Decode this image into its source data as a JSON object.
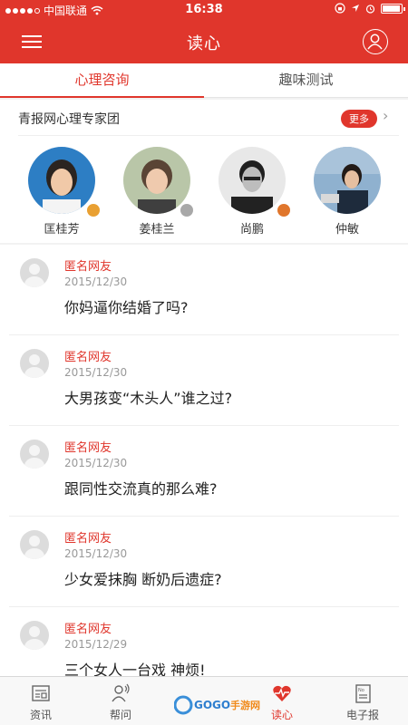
{
  "status_bar": {
    "carrier": "中国联通",
    "time": "16:38"
  },
  "header": {
    "title": "读心"
  },
  "tabs": [
    {
      "label": "心理咨询",
      "active": true
    },
    {
      "label": "趣味测试",
      "active": false
    }
  ],
  "experts": {
    "title": "青报网心理专家团",
    "more_label": "更多",
    "items": [
      {
        "name": "匡桂芳"
      },
      {
        "name": "姜桂兰"
      },
      {
        "name": "尚鹏"
      },
      {
        "name": "仲敏"
      }
    ]
  },
  "questions": [
    {
      "user": "匿名网友",
      "date": "2015/12/30",
      "question": "你妈逼你结婚了吗?"
    },
    {
      "user": "匿名网友",
      "date": "2015/12/30",
      "question": "大男孩变“木头人”谁之过?"
    },
    {
      "user": "匿名网友",
      "date": "2015/12/30",
      "question": "跟同性交流真的那么难?"
    },
    {
      "user": "匿名网友",
      "date": "2015/12/30",
      "question": "少女爱抹胸 断奶后遗症?"
    },
    {
      "user": "匿名网友",
      "date": "2015/12/29",
      "question": " 三个女人一台戏 神烦!"
    }
  ],
  "tabbar": [
    {
      "label": "资讯",
      "icon": "newspaper-icon",
      "active": false
    },
    {
      "label": "帮问",
      "icon": "person-question-icon",
      "active": false
    },
    {
      "label": "读心",
      "icon": "heart-pulse-icon",
      "active": true
    },
    {
      "label": "电子报",
      "icon": "epaper-icon",
      "active": false
    }
  ],
  "watermark": {
    "text": "GOGO手游网"
  },
  "colors": {
    "accent": "#e0362c",
    "background": "#f2f2f2"
  }
}
